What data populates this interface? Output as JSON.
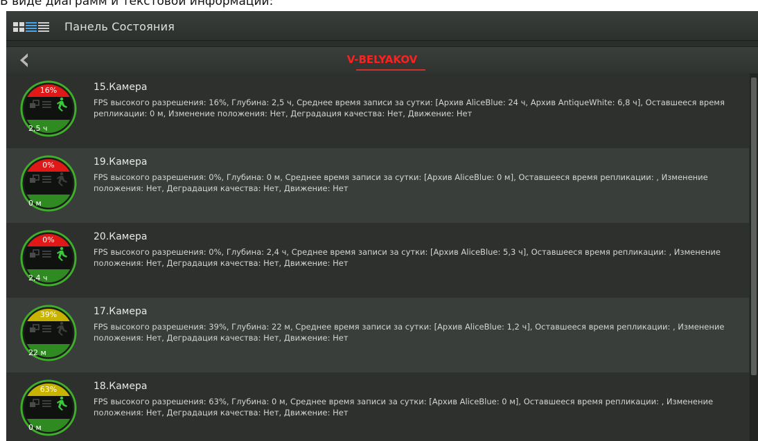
{
  "caption": "В виде диаграмм и текстовой информации:",
  "header": {
    "title": "Панель Состояния",
    "view_icons": [
      "grid-view-icon",
      "list-view-icon",
      "compact-list-icon"
    ]
  },
  "subheader": {
    "host": "V-BELYAKOV"
  },
  "colors": {
    "red": "#e01818",
    "yellow": "#c8b400",
    "green": "#3aa030",
    "host": "#ff2020"
  },
  "cameras": [
    {
      "name": "15.Камера",
      "fps_label": "16%",
      "fps_fraction": 0.16,
      "status_color": "#e01818",
      "depth_label": "2,5 ч",
      "motion_active": true,
      "description": "FPS высокого разрешения: 16%, Глубина: 2,5 ч, Среднее время записи за сутки: [Архив AliceBlue: 24 ч, Архив AntiqueWhite: 6,8 ч], Оставшееся время репликации: 0 м, Изменение положения: Нет, Деградация качества: Нет, Движение: Нет"
    },
    {
      "name": "19.Камера",
      "fps_label": "0%",
      "fps_fraction": 0,
      "status_color": "#e01818",
      "depth_label": "0 м",
      "motion_active": false,
      "description": "FPS высокого разрешения: 0%, Глубина: 0 м, Среднее время записи за сутки: [Архив AliceBlue: 0 м], Оставшееся время репликации: , Изменение положения: Нет, Деградация качества: Нет, Движение: Нет"
    },
    {
      "name": "20.Камера",
      "fps_label": "0%",
      "fps_fraction": 0,
      "status_color": "#e01818",
      "depth_label": "2,4 ч",
      "motion_active": true,
      "description": "FPS высокого разрешения: 0%, Глубина: 2,4 ч, Среднее время записи за сутки: [Архив AliceBlue: 5,3 ч], Оставшееся время репликации: , Изменение положения: Нет, Деградация качества: Нет, Движение: Нет"
    },
    {
      "name": "17.Камера",
      "fps_label": "39%",
      "fps_fraction": 0.39,
      "status_color": "#c8b400",
      "depth_label": "22 м",
      "motion_active": false,
      "description": "FPS высокого разрешения: 39%, Глубина: 22 м, Среднее время записи за сутки: [Архив AliceBlue: 1,2 ч], Оставшееся время репликации: , Изменение положения: Нет, Деградация качества: Нет, Движение: Нет"
    },
    {
      "name": "18.Камера",
      "fps_label": "63%",
      "fps_fraction": 0.63,
      "status_color": "#c8b400",
      "depth_label": "0 м",
      "motion_active": true,
      "description": "FPS высокого разрешения: 63%, Глубина: 0 м, Среднее время записи за сутки: [Архив AliceBlue: 0 м], Оставшееся время репликации: , Изменение положения: Нет, Деградация качества: Нет, Движение: Нет"
    }
  ]
}
